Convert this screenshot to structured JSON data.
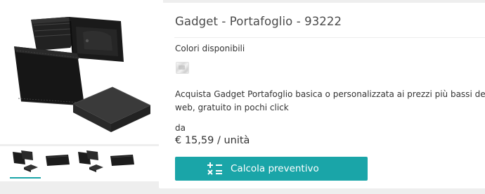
{
  "product": {
    "title": "Gadget - Portafoglio - 93222",
    "colors_label": "Colori disponibili",
    "color_swatches": [
      {
        "name": "silver-grey",
        "color": "#d9d9d9"
      }
    ],
    "description": "Acquista Gadget Portafoglio basica o personalizzata ai prezzi più bassi del web, gratuito in pochi click",
    "price_prefix": "da",
    "price": "€ 15,59 / unità",
    "cta_label": "Calcola preventivo",
    "cta_icon": "calculator-icon"
  },
  "gallery": {
    "main_image": "wallet-with-gift-box",
    "thumbnails": [
      "wallet-thumbnail-1",
      "wallet-thumbnail-2",
      "wallet-thumbnail-3",
      "wallet-thumbnail-4"
    ]
  },
  "colors": {
    "accent": "#1aa5a8",
    "leather": "#1c1c1c",
    "panel_bg": "#ffffff",
    "page_bg": "#eeeeee"
  }
}
